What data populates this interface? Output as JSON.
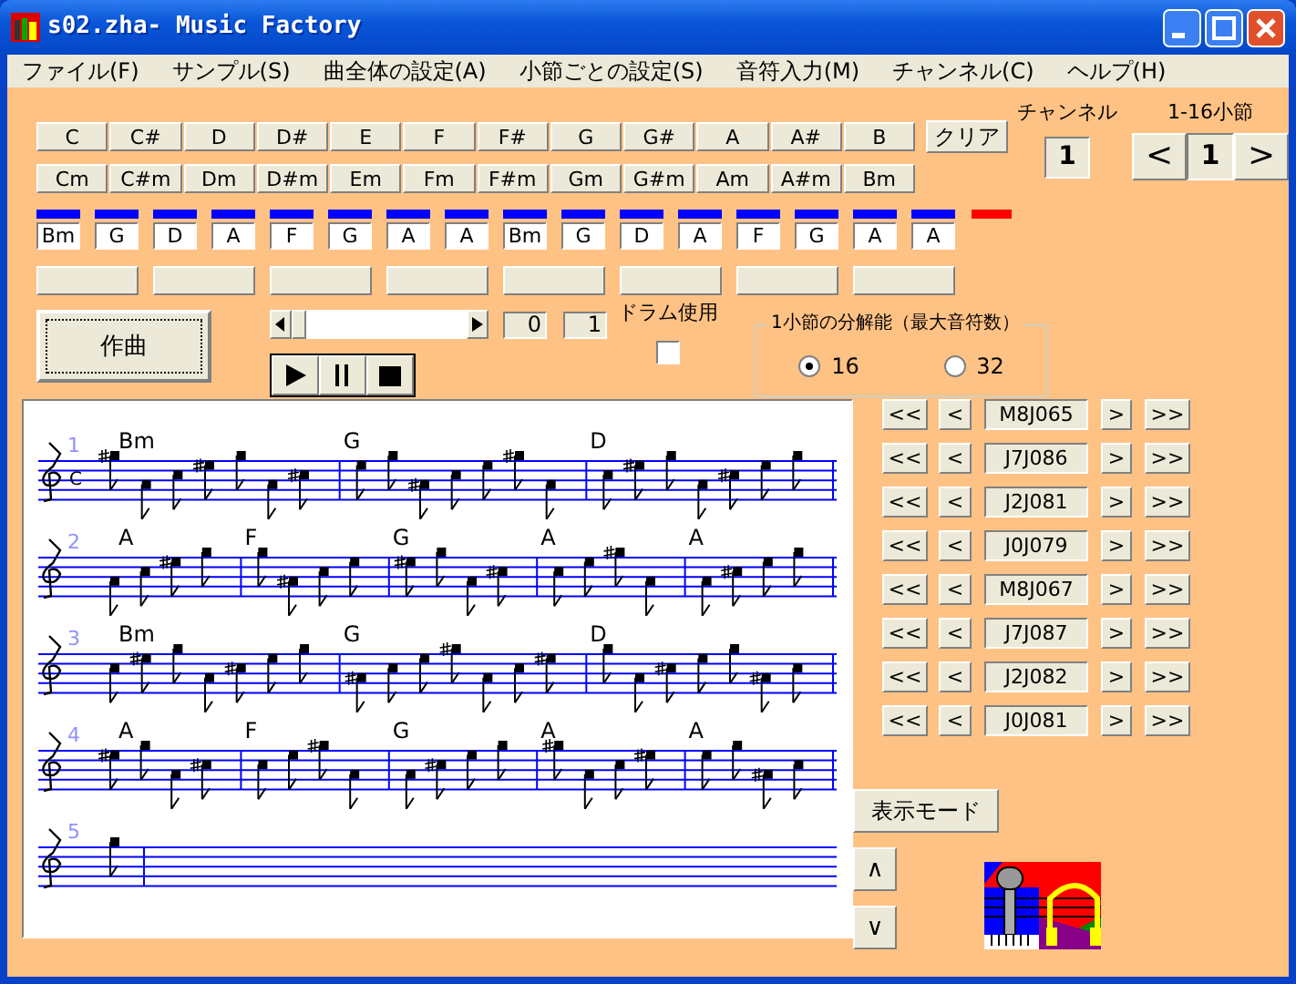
{
  "window": {
    "title": "s02.zha- Music Factory"
  },
  "menu": [
    "ファイル(F)",
    "サンプル(S)",
    "曲全体の設定(A)",
    "小節ごとの設定(S)",
    "音符入力(M)",
    "チャンネル(C)",
    "ヘルプ(H)"
  ],
  "major_chords": [
    "C",
    "C#",
    "D",
    "D#",
    "E",
    "F",
    "F#",
    "G",
    "G#",
    "A",
    "A#",
    "B"
  ],
  "minor_chords": [
    "Cm",
    "C#m",
    "Dm",
    "D#m",
    "Em",
    "Fm",
    "F#m",
    "Gm",
    "G#m",
    "Am",
    "A#m",
    "Bm"
  ],
  "clear_button": "クリア",
  "channel": {
    "label": "チャンネル",
    "value": "1"
  },
  "bar_range": {
    "label": "1-16小節",
    "prev": "<",
    "value": "1",
    "next": ">"
  },
  "bar_slots": [
    {
      "chord": "Bm",
      "color": "#0000ff"
    },
    {
      "chord": "G",
      "color": "#0000ff"
    },
    {
      "chord": "D",
      "color": "#0000ff"
    },
    {
      "chord": "A",
      "color": "#0000ff"
    },
    {
      "chord": "F",
      "color": "#0000ff"
    },
    {
      "chord": "G",
      "color": "#0000ff"
    },
    {
      "chord": "A",
      "color": "#0000ff"
    },
    {
      "chord": "A",
      "color": "#0000ff"
    },
    {
      "chord": "Bm",
      "color": "#0000ff"
    },
    {
      "chord": "G",
      "color": "#0000ff"
    },
    {
      "chord": "D",
      "color": "#0000ff"
    },
    {
      "chord": "A",
      "color": "#0000ff"
    },
    {
      "chord": "F",
      "color": "#0000ff"
    },
    {
      "chord": "G",
      "color": "#0000ff"
    },
    {
      "chord": "A",
      "color": "#0000ff"
    },
    {
      "chord": "A",
      "color": "#0000ff"
    },
    {
      "color": "#ff0000"
    }
  ],
  "compose_button": "作曲",
  "position": {
    "start": "0",
    "end": "1"
  },
  "drum": {
    "label": "ドラム使用",
    "checked": false
  },
  "resolution": {
    "title": "1小節の分解能（最大音符数）",
    "options": [
      {
        "label": "16",
        "selected": true
      },
      {
        "label": "32",
        "selected": false
      }
    ]
  },
  "score": {
    "staves": [
      {
        "number": "1",
        "time_signature": "C",
        "measures": [
          {
            "chord": "Bm"
          },
          {
            "chord": "G"
          },
          {
            "chord": "D"
          }
        ]
      },
      {
        "number": "2",
        "measures": [
          {
            "chord": "A"
          },
          {
            "chord": "F"
          },
          {
            "chord": "G"
          },
          {
            "chord": "A"
          },
          {
            "chord": "A"
          }
        ]
      },
      {
        "number": "3",
        "measures": [
          {
            "chord": "Bm"
          },
          {
            "chord": "G"
          },
          {
            "chord": "D"
          }
        ]
      },
      {
        "number": "4",
        "measures": [
          {
            "chord": "A"
          },
          {
            "chord": "F"
          },
          {
            "chord": "G"
          },
          {
            "chord": "A"
          },
          {
            "chord": "A"
          }
        ]
      },
      {
        "number": "5"
      }
    ]
  },
  "patterns": [
    {
      "first": "<<",
      "prev": "<",
      "code": "M8J065",
      "next": ">",
      "last": ">>"
    },
    {
      "first": "<<",
      "prev": "<",
      "code": "J7J086",
      "next": ">",
      "last": ">>"
    },
    {
      "first": "<<",
      "prev": "<",
      "code": "J2J081",
      "next": ">",
      "last": ">>"
    },
    {
      "first": "<<",
      "prev": "<",
      "code": "J0J079",
      "next": ">",
      "last": ">>"
    },
    {
      "first": "<<",
      "prev": "<",
      "code": "M8J067",
      "next": ">",
      "last": ">>"
    },
    {
      "first": "<<",
      "prev": "<",
      "code": "J7J087",
      "next": ">",
      "last": ">>"
    },
    {
      "first": "<<",
      "prev": "<",
      "code": "J2J082",
      "next": ">",
      "last": ">>"
    },
    {
      "first": "<<",
      "prev": "<",
      "code": "J0J081",
      "next": ">",
      "last": ">>"
    }
  ],
  "display_mode_button": "表示モード",
  "scroll_up": "∧",
  "scroll_down": "∨"
}
